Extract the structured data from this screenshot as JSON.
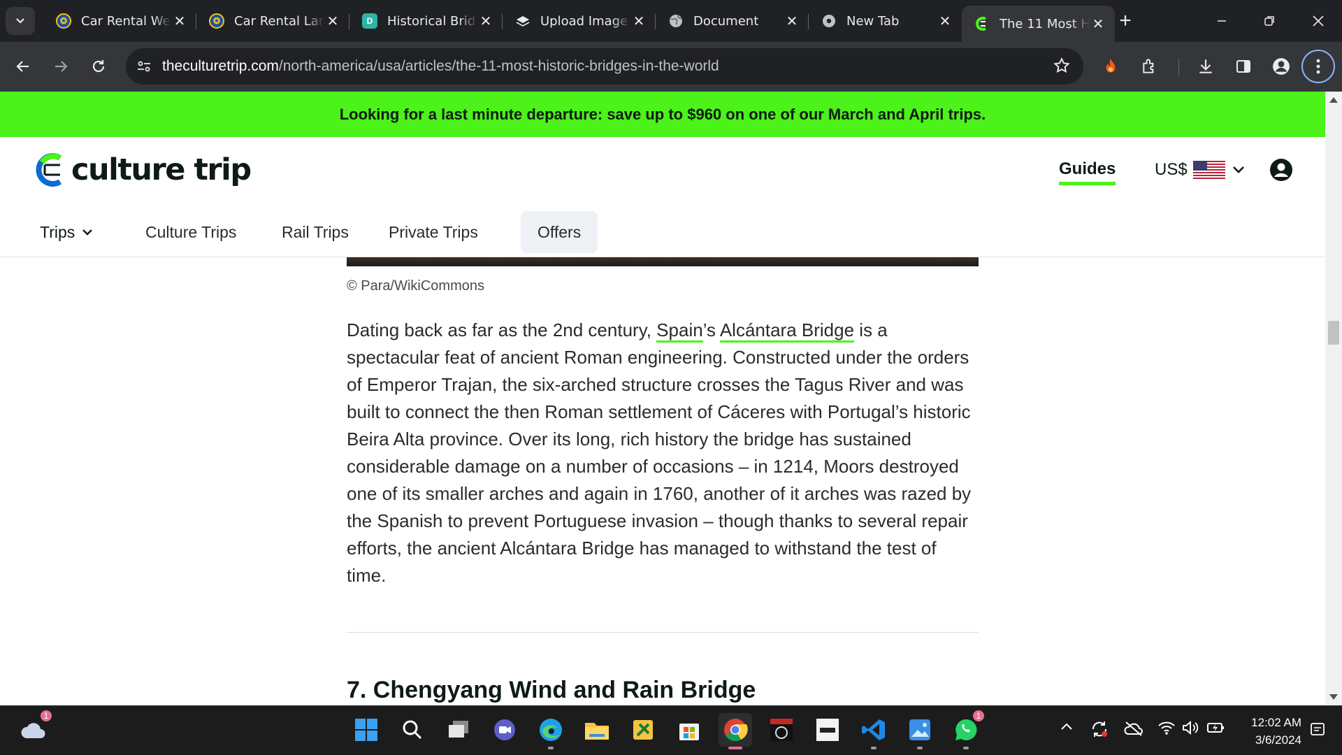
{
  "browser": {
    "tabs": [
      {
        "title": "Car Rental We",
        "icon": "car-rental-favicon"
      },
      {
        "title": "Car Rental Lar",
        "icon": "car-rental-favicon"
      },
      {
        "title": "Historical Brid",
        "icon": "d-app-favicon"
      },
      {
        "title": "Upload Image",
        "icon": "layers-favicon"
      },
      {
        "title": "Document",
        "icon": "globe-favicon"
      },
      {
        "title": "New Tab",
        "icon": "chrome-favicon"
      },
      {
        "title": "The 11 Most H",
        "icon": "culture-trip-favicon",
        "active": true
      }
    ],
    "url_host": "theculturetrip.com",
    "url_path": "/north-america/usa/articles/the-11-most-historic-bridges-in-the-world"
  },
  "page": {
    "promo_banner": "Looking for a last minute departure: save up to $960 on one of our March and April trips.",
    "logo_text": "culture trip",
    "guides_label": "Guides",
    "currency_label": "US$",
    "nav": {
      "trips": "Trips",
      "culture_trips": "Culture Trips",
      "rail_trips": "Rail Trips",
      "private_trips": "Private Trips",
      "offers": "Offers"
    },
    "image_credit": "© Para/WikiCommons",
    "paragraph": {
      "p1": "Dating back as far as the 2nd century, ",
      "link_spain": "Spain",
      "p2": "’s ",
      "link_bridge": "Alcántara Bridge",
      "p3": " is a spectacular feat of ancient Roman engineering. Constructed under the orders of Emperor Trajan, the six-arched structure crosses the Tagus River and was built to connect the then Roman settlement of Cáceres with Portugal’s historic Beira Alta province. Over its long, rich history the bridge has sustained considerable damage on a number of occasions – in 1214, Moors destroyed one of its smaller arches and again in 1760, another of it arches was razed by the Spanish to prevent Portuguese invasion – though thanks to several repair efforts, the ancient Alcántara Bridge has managed to withstand the test of time."
    },
    "next_heading": "7. Chengyang Wind and Rain Bridge",
    "accent_color": "#4cf21a"
  },
  "taskbar": {
    "weather_badge": "1",
    "whatsapp_badge": "1",
    "time": "12:02 AM",
    "date": "3/6/2024"
  }
}
